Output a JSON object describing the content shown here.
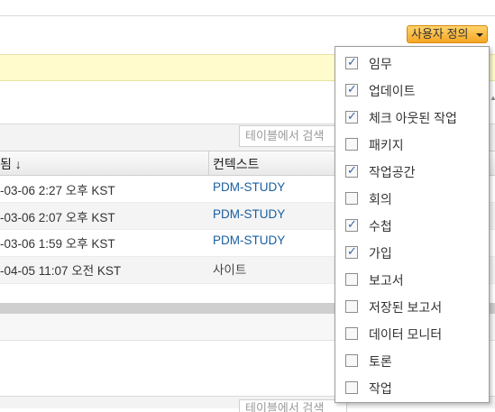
{
  "toolbar": {
    "custom_label": "사용자 정의"
  },
  "table": {
    "search_placeholder": "테이블에서 검색",
    "headers": {
      "modified": "됨 ↓",
      "context": "컨텍스트"
    },
    "rows": [
      {
        "modified": "-03-06 2:27 오후 KST",
        "context": "PDM-STUDY"
      },
      {
        "modified": "-03-06 2:07 오후 KST",
        "context": "PDM-STUDY"
      },
      {
        "modified": "-03-06 1:59 오후 KST",
        "context": "PDM-STUDY"
      },
      {
        "modified": "-04-05 11:07 오전 KST",
        "context": "사이트"
      }
    ]
  },
  "bottom": {
    "search_placeholder": "테이블에서 검색"
  },
  "menu": {
    "items": [
      {
        "label": "임무",
        "checked": true
      },
      {
        "label": "업데이트",
        "checked": true
      },
      {
        "label": "체크 아웃된 작업",
        "checked": true
      },
      {
        "label": "패키지",
        "checked": false
      },
      {
        "label": "작업공간",
        "checked": true
      },
      {
        "label": "회의",
        "checked": false
      },
      {
        "label": "수첩",
        "checked": true
      },
      {
        "label": "가입",
        "checked": true
      },
      {
        "label": "보고서",
        "checked": false
      },
      {
        "label": "저장된 보고서",
        "checked": false
      },
      {
        "label": "데이터 모니터",
        "checked": false
      },
      {
        "label": "토론",
        "checked": false
      },
      {
        "label": "작업",
        "checked": false
      }
    ],
    "check_glyph": "✓"
  }
}
